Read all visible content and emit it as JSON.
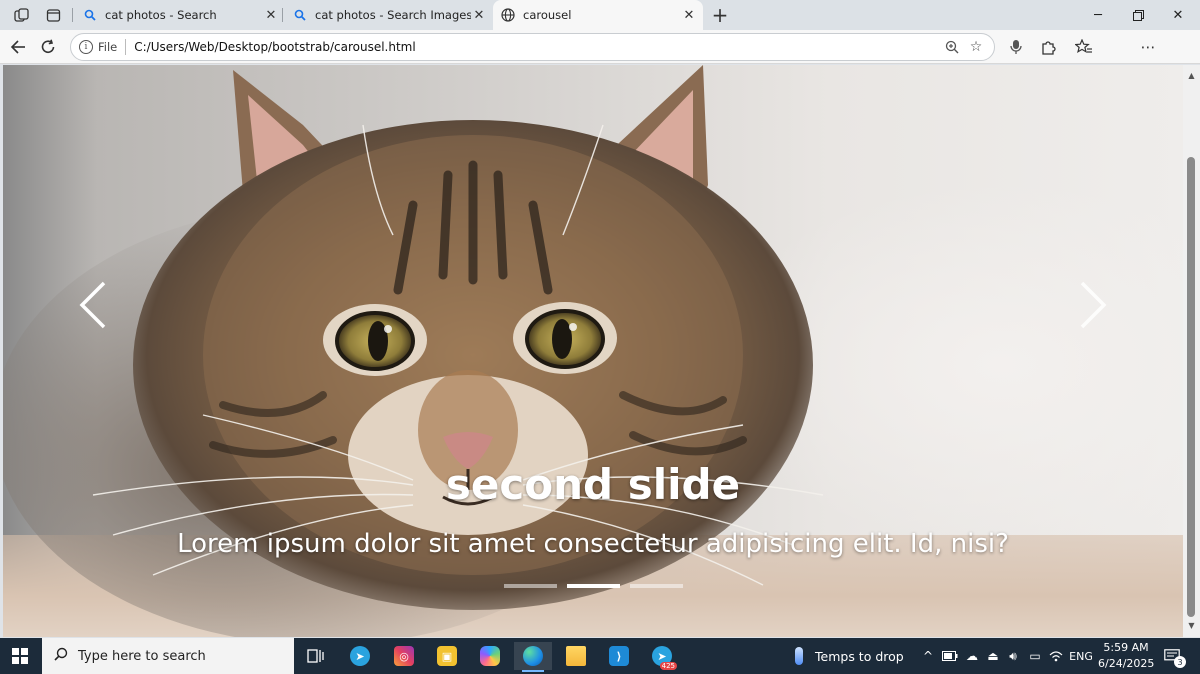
{
  "browser": {
    "tabs": [
      {
        "title": "cat photos - Search",
        "icon": "search-icon",
        "active": false
      },
      {
        "title": "cat photos - Search Images",
        "icon": "search-icon",
        "active": false
      },
      {
        "title": "carousel",
        "icon": "globe-icon",
        "active": true
      }
    ],
    "address": {
      "scheme_label": "File",
      "url": "C:/Users/Web/Desktop/bootstrab/carousel.html"
    }
  },
  "carousel": {
    "slide_title": "second slide",
    "slide_text": "Lorem ipsum dolor sit amet consectetur adipisicing elit. Id, nisi?",
    "indicator_count": 3,
    "active_index": 1
  },
  "taskbar": {
    "search_placeholder": "Type here to search",
    "weather_text": "Temps to drop",
    "language": "ENG",
    "time": "5:59 AM",
    "date": "6/24/2025",
    "telegram_badge": "425",
    "notification_count": "3"
  },
  "colors": {
    "taskbar_bg": "#1c2b3a",
    "tab_strip_bg": "#dce1e6",
    "toolbar_bg": "#f7f7f7"
  }
}
